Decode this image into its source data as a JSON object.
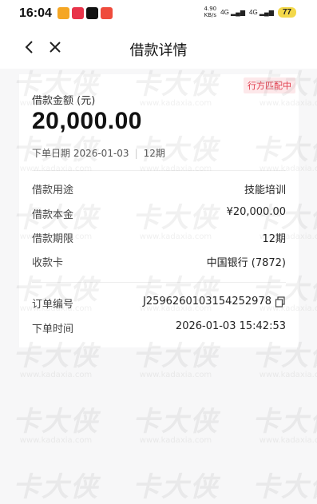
{
  "status_bar": {
    "time": "16:04",
    "net_speed": "4.90",
    "net_unit": "KB/s",
    "signal1": "4G",
    "signal2": "4G",
    "battery": "77"
  },
  "nav": {
    "title": "借款详情"
  },
  "loan": {
    "status_badge": "行方匹配中",
    "amount_label": "借款金额 (元)",
    "amount": "20,000.00",
    "order_date": "下单日期 2026-01-03",
    "term_short": "12期"
  },
  "details": [
    {
      "key": "借款用途",
      "value": "技能培训"
    },
    {
      "key": "借款本金",
      "value": "¥20,000.00"
    },
    {
      "key": "借款期限",
      "value": "12期"
    },
    {
      "key": "收款卡",
      "value": "中国银行 (7872)"
    }
  ],
  "order": [
    {
      "key": "订单编号",
      "value": "J2596260103154252978"
    },
    {
      "key": "下单时间",
      "value": "2026-01-03 15:42:53"
    }
  ],
  "watermark": {
    "big": "卡大侠",
    "small": "www.kadaxia.com"
  },
  "colors": {
    "badge_bg": "#fde8ea",
    "badge_text": "#e03a4a",
    "battery": "#f3d84a"
  }
}
